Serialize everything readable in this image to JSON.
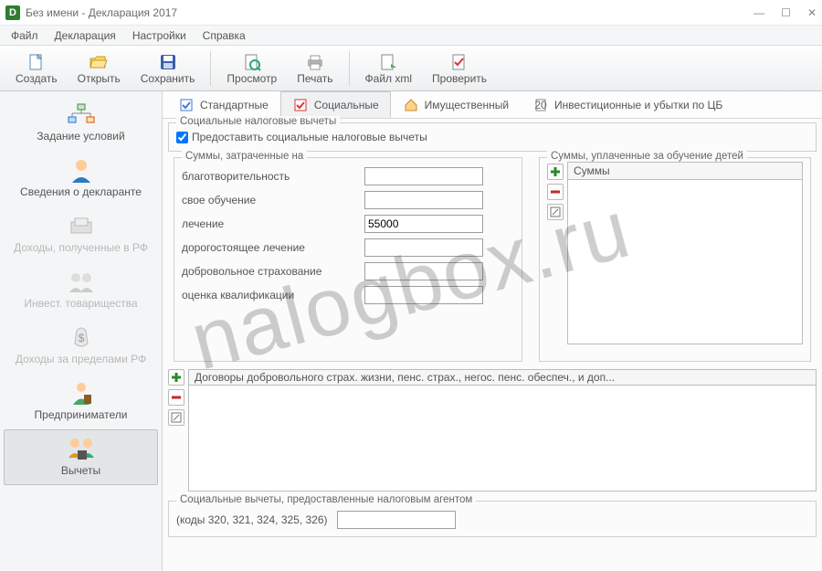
{
  "titlebar": {
    "app_letter": "D",
    "title": "Без имени - Декларация 2017"
  },
  "menu": {
    "file": "Файл",
    "declaration": "Декларация",
    "settings": "Настройки",
    "help": "Справка"
  },
  "toolbar": {
    "create": "Создать",
    "open": "Открыть",
    "save": "Сохранить",
    "preview": "Просмотр",
    "print": "Печать",
    "filexml": "Файл xml",
    "check": "Проверить"
  },
  "sidebar": {
    "items": [
      {
        "label": "Задание условий"
      },
      {
        "label": "Сведения о декларанте"
      },
      {
        "label": "Доходы, полученные в РФ"
      },
      {
        "label": "Инвест. товарищества"
      },
      {
        "label": "Доходы за пределами РФ"
      },
      {
        "label": "Предприниматели"
      },
      {
        "label": "Вычеты"
      }
    ]
  },
  "tabs": {
    "standard": "Стандартные",
    "social": "Социальные",
    "property": "Имущественный",
    "invest": "Инвестиционные и убытки по ЦБ"
  },
  "group_deductions": {
    "legend": "Социальные налоговые вычеты",
    "checkbox": "Предоставить социальные налоговые вычеты"
  },
  "sums_spent": {
    "legend": "Суммы, затраченные на",
    "charity": "благотворительность",
    "self_edu": "свое обучение",
    "treatment": "лечение",
    "treatment_val": "55000",
    "expensive_treatment": "дорогостоящее лечение",
    "vol_insurance": "добровольное страхование",
    "qualification": "оценка квалификации"
  },
  "sums_children": {
    "legend": "Суммы, уплаченные за обучение детей",
    "header": "Суммы"
  },
  "contracts": {
    "header": "Договоры добровольного страх. жизни, пенс. страх., негос. пенс. обеспеч., и доп..."
  },
  "agent": {
    "legend": "Социальные вычеты, предоставленные налоговым агентом",
    "codes": "(коды 320, 321, 324, 325, 326)"
  },
  "watermark": "nalogbox.ru"
}
